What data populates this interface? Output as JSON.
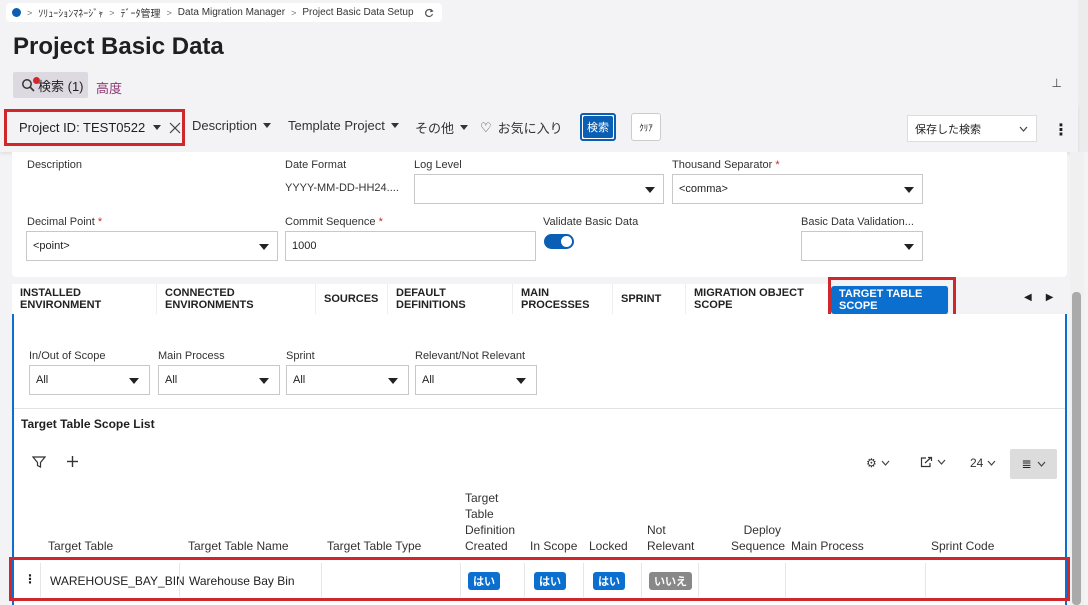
{
  "breadcrumb": {
    "items": [
      "ｿﾘｭｰｼｮﾝﾏﾈｰｼﾞｬ",
      "ﾃﾞｰﾀ管理",
      "Data Migration Manager",
      "Project Basic Data Setup"
    ]
  },
  "page": {
    "title": "Project Basic Data"
  },
  "search_chip": {
    "label": "検索 (1)"
  },
  "advanced": {
    "label": "高度"
  },
  "filters": {
    "project_id": "Project ID: TEST0522",
    "description": "Description",
    "template_project": "Template Project",
    "other": "その他",
    "favorites": "お気に入り",
    "search_button": "検索",
    "clear_button": "ｸﾘｱ",
    "saved_search": "保存した検索"
  },
  "form": {
    "description_label": "Description",
    "date_format_label": "Date Format",
    "date_format_value": "YYYY-MM-DD-HH24....",
    "log_level_label": "Log Level",
    "log_level_value": "",
    "thousand_sep_label": "Thousand Separator",
    "thousand_sep_value": "<comma>",
    "decimal_point_label": "Decimal Point",
    "decimal_point_value": "<point>",
    "commit_seq_label": "Commit Sequence",
    "commit_seq_value": "1000",
    "validate_label": "Validate Basic Data",
    "validate_on": true,
    "basic_validation_label": "Basic Data Validation...",
    "basic_validation_value": "",
    "required_mark": "*"
  },
  "tabs": [
    {
      "label": "INSTALLED ENVIRONMENT"
    },
    {
      "label": "CONNECTED ENVIRONMENTS"
    },
    {
      "label": "SOURCES"
    },
    {
      "label": "DEFAULT DEFINITIONS"
    },
    {
      "label": "MAIN PROCESSES"
    },
    {
      "label": "SPRINT"
    },
    {
      "label": "MIGRATION OBJECT SCOPE"
    },
    {
      "label": "TARGET TABLE SCOPE"
    }
  ],
  "scope_filters": {
    "in_out_label": "In/Out of Scope",
    "in_out_value": "All",
    "main_process_label": "Main Process",
    "main_process_value": "All",
    "sprint_label": "Sprint",
    "sprint_value": "All",
    "relevant_label": "Relevant/Not Relevant",
    "relevant_value": "All"
  },
  "list": {
    "title": "Target Table Scope List",
    "page_size": "24",
    "columns": {
      "target_table": "Target Table",
      "target_table_name": "Target Table Name",
      "target_table_type": "Target Table Type",
      "definition_created_1": "Target",
      "definition_created_2": "Table",
      "definition_created_3": "Definition",
      "definition_created_4": "Created",
      "in_scope": "In Scope",
      "locked": "Locked",
      "not_relevant_1": "Not",
      "not_relevant_2": "Relevant",
      "deploy_seq_1": "Deploy",
      "deploy_seq_2": "Sequence",
      "main_process": "Main Process",
      "sprint_code": "Sprint Code"
    },
    "row": {
      "target_table": "WAREHOUSE_BAY_BIN",
      "target_table_name": "Warehouse Bay Bin",
      "target_table_type": "",
      "definition_created": "はい",
      "in_scope": "はい",
      "locked": "はい",
      "not_relevant": "いいえ",
      "deploy_sequence": "",
      "main_process": "",
      "sprint_code": ""
    }
  }
}
